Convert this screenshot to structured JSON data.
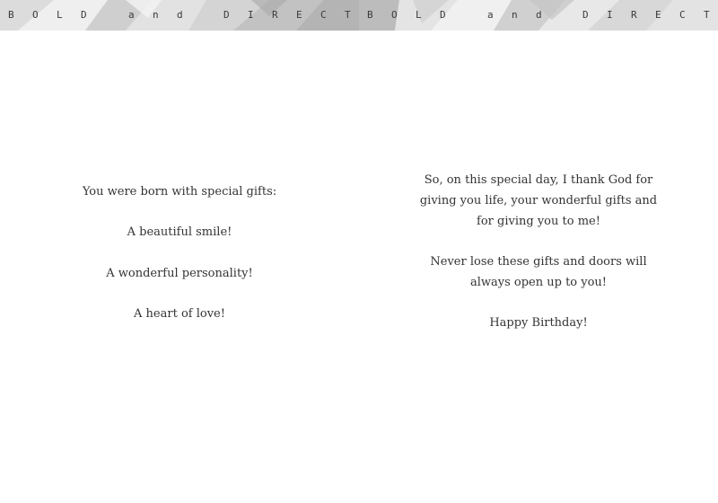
{
  "banner": {
    "title": "BOLD and DIRECT"
  },
  "left_panel": {
    "lines": [
      "You were born with special gifts:",
      "A beautiful smile!",
      "A wonderful personality!",
      "A heart of love!"
    ]
  },
  "right_panel": {
    "paragraphs": [
      "So, on this special day, I thank God for giving you life, your wonderful gifts and for giving you to me!",
      "Never lose these gifts and doors will always open up to you!",
      "Happy Birthday!"
    ]
  },
  "colors": {
    "banner_light": "#e9e9e9",
    "banner_mid": "#cfcfcf",
    "banner_dark": "#b4b4b4",
    "text": "#333333"
  }
}
